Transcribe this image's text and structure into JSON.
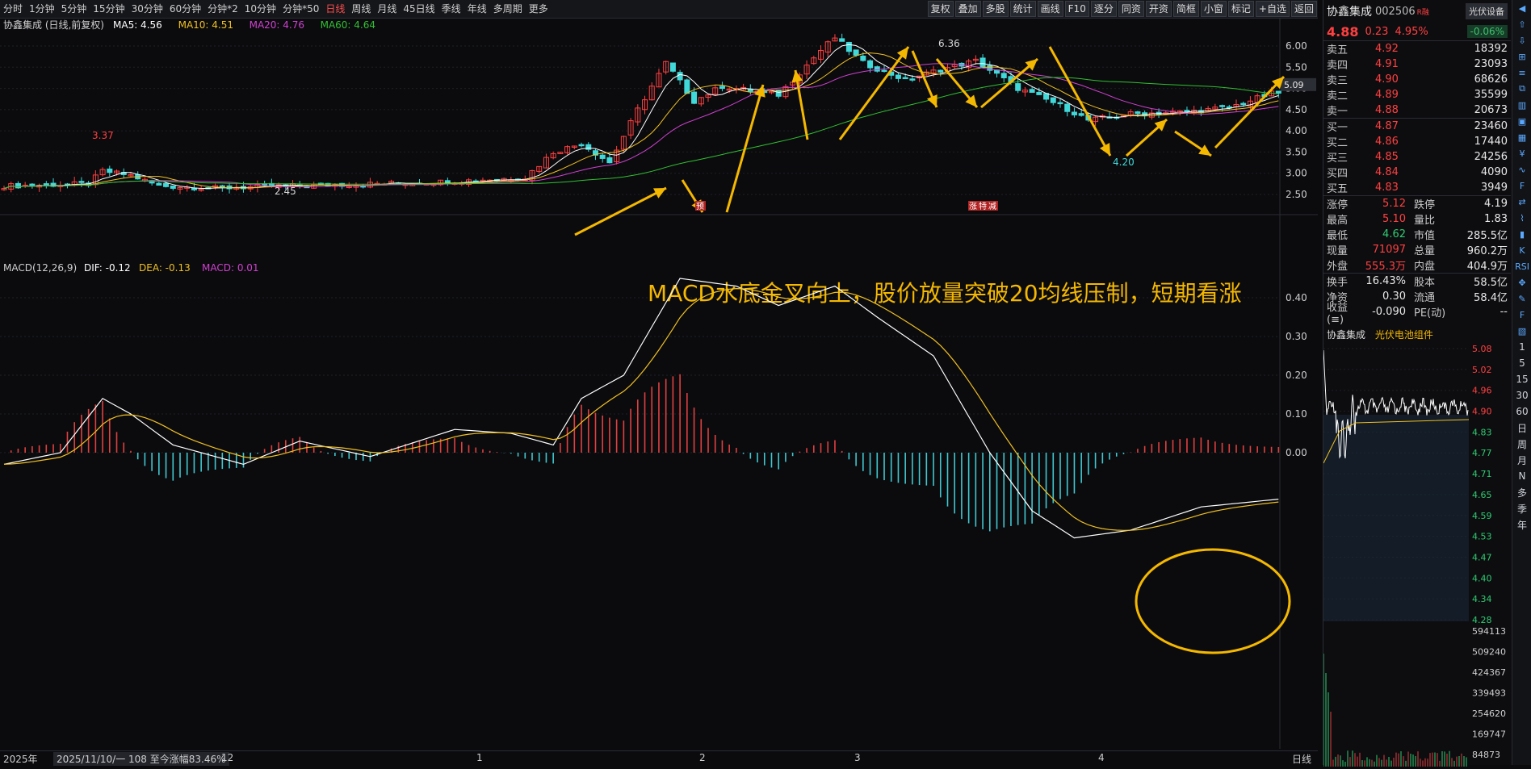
{
  "toolbar": {
    "periods": [
      "分时",
      "1分钟",
      "5分钟",
      "15分钟",
      "30分钟",
      "60分钟",
      "分钟*2",
      "10分钟",
      "分钟*50",
      "日线",
      "周线",
      "月线",
      "45日线",
      "季线",
      "年线",
      "多周期",
      "更多"
    ],
    "active_period": "日线",
    "tools": [
      "复权",
      "叠加",
      "多股",
      "统计",
      "画线",
      "F10",
      "逐分",
      "同资",
      "开资",
      "简框",
      "小窗",
      "标记",
      "+自选",
      "返回"
    ]
  },
  "main_chart": {
    "stock_label": "协鑫集成 (日线,前复权)",
    "ma_labels": [
      {
        "text": "MA5: 4.56",
        "color": "#ffffff"
      },
      {
        "text": "MA10: 4.51",
        "color": "#f0c020"
      },
      {
        "text": "MA20: 4.76",
        "color": "#d040d0"
      },
      {
        "text": "MA60: 4.64",
        "color": "#30c030"
      }
    ],
    "y_ticks": [
      "6.00",
      "5.50",
      "5.00",
      "4.50",
      "4.00",
      "3.50",
      "3.00",
      "2.50"
    ],
    "current_price_tag": "5.09",
    "high_label": "6.36",
    "low_label": "2.45",
    "mark_337": "3.37",
    "mark_420": "4.20",
    "event_tags": [
      "预",
      "涨",
      "特",
      "减"
    ]
  },
  "macd_panel": {
    "label": "MACD(12,26,9)",
    "dif": "DIF: -0.12",
    "dea": "DEA: -0.13",
    "macd": "MACD: 0.01",
    "y_ticks": [
      "0.40",
      "0.30",
      "0.20",
      "0.10",
      "0.00"
    ],
    "annotation": "MACD水底金叉向上，股价放量突破20均线压制，短期看涨"
  },
  "bottom_bar": {
    "year": "2025年",
    "range_info": "2025/11/10/一 108 至今涨幅83.46%",
    "months": [
      "12",
      "1",
      "2",
      "3",
      "4"
    ],
    "period": "日线"
  },
  "quote": {
    "name": "协鑫集成",
    "code": "002506",
    "rz": "R融",
    "tag": "光伏设备",
    "price": "4.88",
    "change": "0.23",
    "change_pct": "4.95%",
    "small_pct": "-0.06%",
    "asks": [
      {
        "label": "卖五",
        "price": "4.92",
        "vol": "18392"
      },
      {
        "label": "卖四",
        "price": "4.91",
        "vol": "23093"
      },
      {
        "label": "卖三",
        "price": "4.90",
        "vol": "68626"
      },
      {
        "label": "卖二",
        "price": "4.89",
        "vol": "35599"
      },
      {
        "label": "卖一",
        "price": "4.88",
        "vol": "20673"
      }
    ],
    "bids": [
      {
        "label": "买一",
        "price": "4.87",
        "vol": "23460"
      },
      {
        "label": "买二",
        "price": "4.86",
        "vol": "17440"
      },
      {
        "label": "买三",
        "price": "4.85",
        "vol": "24256"
      },
      {
        "label": "买四",
        "price": "4.84",
        "vol": "4090"
      },
      {
        "label": "买五",
        "price": "4.83",
        "vol": "3949"
      }
    ],
    "stats": [
      {
        "l1": "涨停",
        "v1": "5.12",
        "c1": "red",
        "l2": "跌停",
        "v2": "4.19",
        "c2": "green"
      },
      {
        "l1": "最高",
        "v1": "5.10",
        "c1": "red",
        "l2": "量比",
        "v2": "1.83",
        "c2": "red"
      },
      {
        "l1": "最低",
        "v1": "4.62",
        "c1": "green",
        "l2": "市值",
        "v2": "285.5亿",
        "c2": "white"
      },
      {
        "l1": "现量",
        "v1": "71097",
        "c1": "red",
        "l2": "总量",
        "v2": "960.2万",
        "c2": "white"
      },
      {
        "l1": "外盘",
        "v1": "555.3万",
        "c1": "red",
        "l2": "内盘",
        "v2": "404.9万",
        "c2": "green"
      }
    ],
    "stats2": [
      {
        "l1": "换手",
        "v1": "16.43%",
        "c1": "white",
        "l2": "股本",
        "v2": "58.5亿",
        "c2": "white"
      },
      {
        "l1": "净资",
        "v1": "0.30",
        "c1": "white",
        "l2": "流通",
        "v2": "58.4亿",
        "c2": "white"
      },
      {
        "l1": "收益(≡)",
        "v1": "-0.090",
        "c1": "white",
        "l2": "PE(动)",
        "v2": "--",
        "c2": "white"
      }
    ]
  },
  "mini_chart": {
    "name": "协鑫集成",
    "sector": "光伏电池组件",
    "price_ticks": [
      "5.08",
      "5.02",
      "4.96",
      "4.90",
      "4.83",
      "4.77",
      "4.71",
      "4.65",
      "4.59",
      "4.53",
      "4.47",
      "4.40",
      "4.34",
      "4.28"
    ],
    "vol_ticks": [
      "594113",
      "509240",
      "424367",
      "339493",
      "254620",
      "169747",
      "84873"
    ]
  },
  "sidebar": {
    "periods": [
      "1",
      "5",
      "15",
      "30",
      "60",
      "日",
      "周",
      "月",
      "N",
      "多",
      "季",
      "年"
    ]
  },
  "colors": {
    "up": "#ff4040",
    "down": "#40d8d8",
    "arrow": "#f5b800"
  }
}
